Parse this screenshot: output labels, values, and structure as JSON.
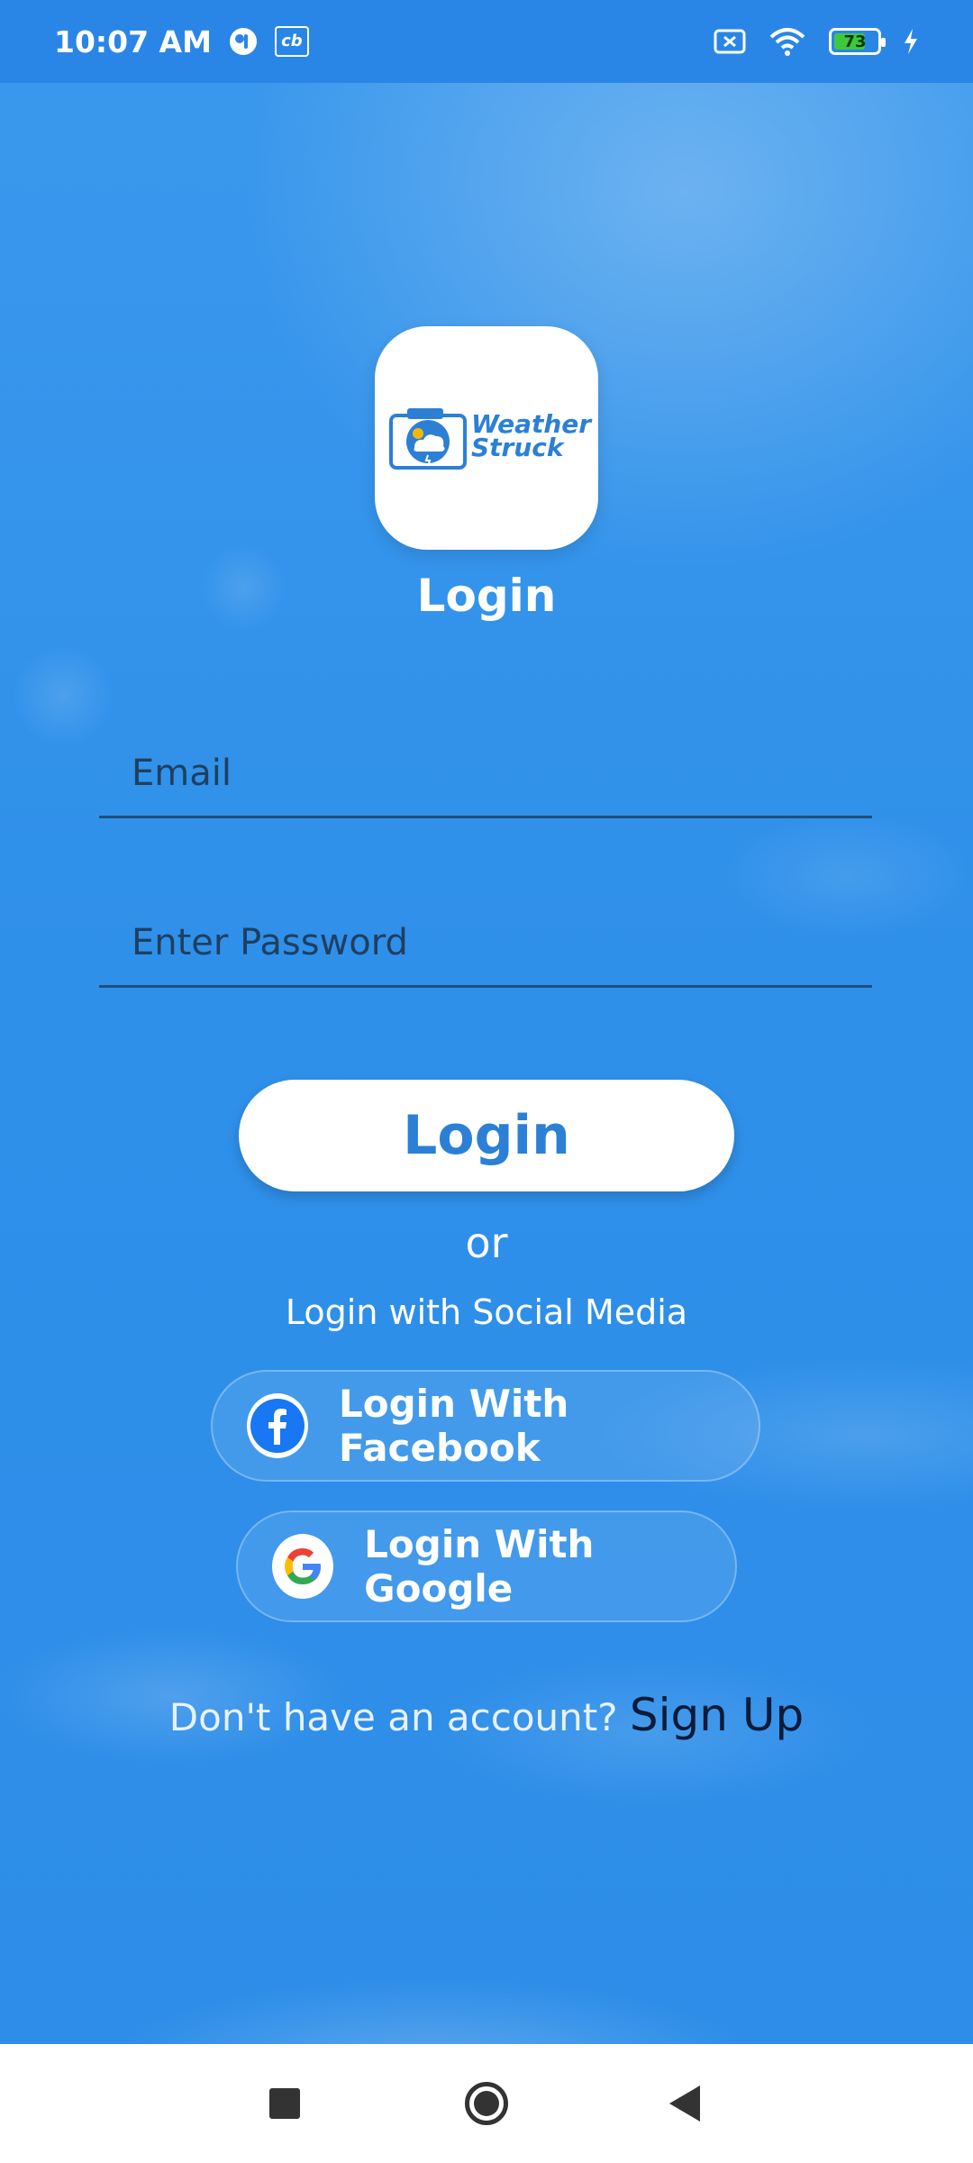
{
  "status_bar": {
    "time": "10:07 AM",
    "cb_badge": "cb",
    "battery_level": "73",
    "battery_percent": 73,
    "icons": [
      "notification-icon",
      "cb-icon",
      "screen-record-icon",
      "wifi-icon",
      "battery-icon",
      "charging-icon"
    ]
  },
  "logo": {
    "line1": "Weather",
    "line2": "Struck",
    "color": "#2b80d6"
  },
  "login": {
    "title": "Login",
    "email_placeholder": "Email",
    "password_placeholder": "Enter Password",
    "button_label": "Login",
    "or_text": "or",
    "social_text": "Login with Social Media",
    "facebook_label": "Login With Facebook",
    "google_label": "Login With Google",
    "no_account_text": "Don't have an account?",
    "signup_label": "Sign Up"
  },
  "colors": {
    "accent": "#2b80d6",
    "background": "#2d8de8",
    "facebook": "#1877f2"
  },
  "nav_bar": {
    "icons": [
      "recents-icon",
      "home-icon",
      "back-icon"
    ]
  }
}
